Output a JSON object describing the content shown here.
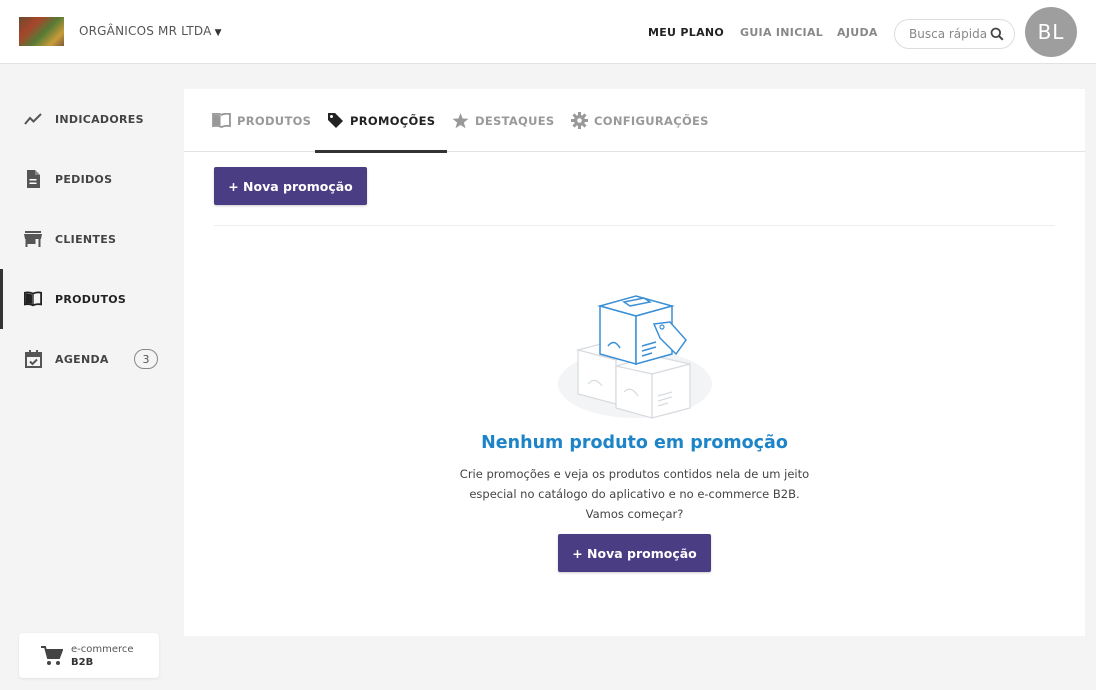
{
  "header": {
    "company_name": "ORGÂNICOS MR LTDA",
    "nav": [
      "MEU PLANO",
      "GUIA INICIAL",
      "AJUDA"
    ],
    "search_placeholder": "Busca rápida",
    "avatar_initials": "BL"
  },
  "sidebar": {
    "items": [
      {
        "label": "INDICADORES",
        "icon": "chart-line-icon"
      },
      {
        "label": "PEDIDOS",
        "icon": "document-icon"
      },
      {
        "label": "CLIENTES",
        "icon": "store-icon"
      },
      {
        "label": "PRODUTOS",
        "icon": "book-icon",
        "active": true
      },
      {
        "label": "AGENDA",
        "icon": "calendar-check-icon",
        "badge": "3"
      }
    ],
    "ecommerce": {
      "line1": "e-commerce",
      "line2": "B2B",
      "icon": "cart-icon"
    }
  },
  "tabs": [
    {
      "label": "PRODUTOS",
      "icon": "book-icon"
    },
    {
      "label": "PROMOÇÕES",
      "icon": "tag-icon",
      "active": true
    },
    {
      "label": "DESTAQUES",
      "icon": "star-icon"
    },
    {
      "label": "CONFIGURAÇÕES",
      "icon": "gear-icon"
    }
  ],
  "main": {
    "new_promo_label": "+ Nova promoção",
    "empty_title": "Nenhum produto em promoção",
    "empty_desc_line1": "Crie promoções e veja os produtos contidos nela de um jeito",
    "empty_desc_line2": "especial no catálogo do aplicativo e no e-commerce B2B.",
    "empty_desc_line3": "Vamos começar?",
    "cta_label": "+ Nova promoção"
  },
  "colors": {
    "primary_button": "#4b3d83",
    "title_blue": "#1d84c8",
    "illustration_blue": "#3b8fd6"
  }
}
